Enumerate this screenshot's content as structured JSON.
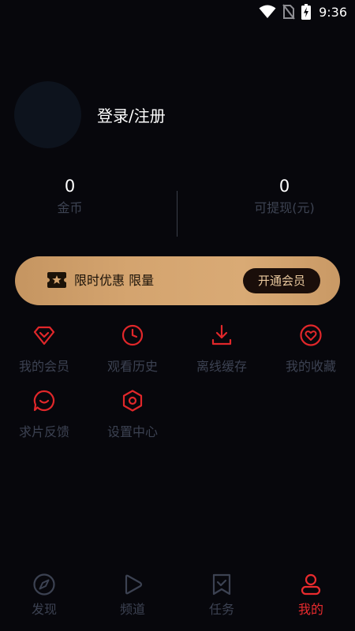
{
  "status_bar": {
    "time": "9:36"
  },
  "profile": {
    "login_label": "登录/注册"
  },
  "stats": {
    "coins": {
      "value": "0",
      "label": "金币"
    },
    "withdrawable": {
      "value": "0",
      "label": "可提现(元)"
    }
  },
  "vip_banner": {
    "text": "限时优惠 限量",
    "button_label": "开通会员"
  },
  "menu": [
    {
      "label": "我的会员",
      "icon": "diamond-icon"
    },
    {
      "label": "观看历史",
      "icon": "clock-icon"
    },
    {
      "label": "离线缓存",
      "icon": "download-icon"
    },
    {
      "label": "我的收藏",
      "icon": "heart-icon"
    },
    {
      "label": "求片反馈",
      "icon": "chat-icon"
    },
    {
      "label": "设置中心",
      "icon": "settings-icon"
    }
  ],
  "tabs": [
    {
      "label": "发现",
      "icon": "compass-icon",
      "active": false
    },
    {
      "label": "频道",
      "icon": "play-icon",
      "active": false
    },
    {
      "label": "任务",
      "icon": "bookmark-icon",
      "active": false
    },
    {
      "label": "我的",
      "icon": "user-icon",
      "active": true
    }
  ],
  "colors": {
    "background": "#07070c",
    "accent": "#ea2b2e",
    "muted_text": "#3c4252",
    "vip_gold": "#d4a46f",
    "vip_button": "#1a0e0a"
  }
}
